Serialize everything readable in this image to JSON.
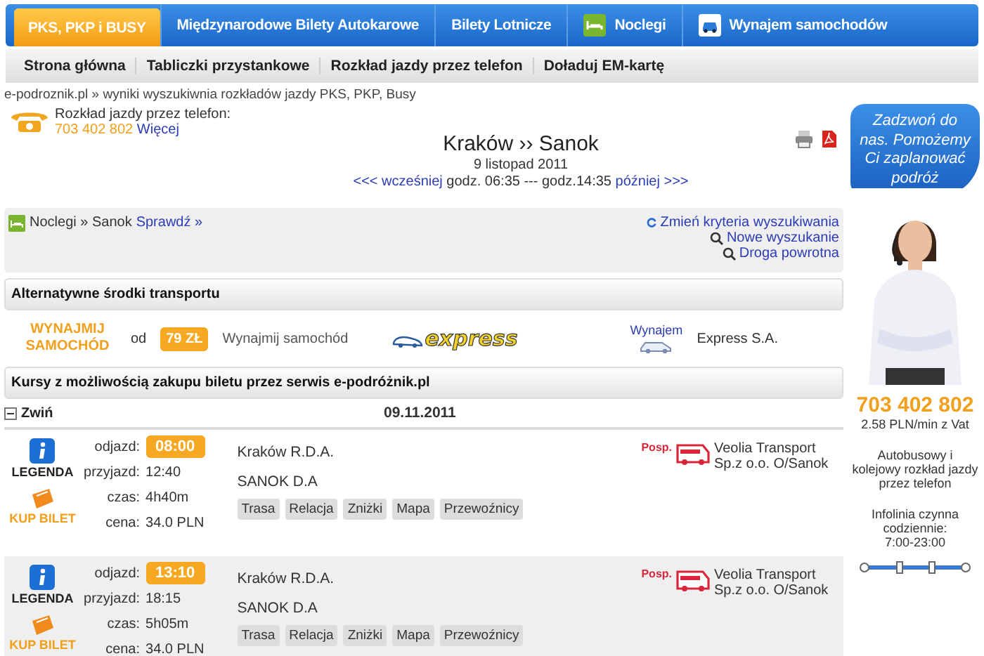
{
  "tabs": [
    {
      "label": "PKS, PKP i BUSY",
      "selected": true
    },
    {
      "label": "Międzynarodowe Bilety Autokarowe",
      "selected": false
    },
    {
      "label": "Bilety Lotnicze",
      "selected": false
    },
    {
      "label": "Noclegi",
      "selected": false
    },
    {
      "label": "Wynajem samochodów",
      "selected": false
    }
  ],
  "subnav": [
    "Strona główna",
    "Tabliczki przystankowe",
    "Rozkład jazdy przez telefon",
    "Doładuj EM-kartę"
  ],
  "breadcrumb": "e-podroznik.pl » wyniki wyszukiwnia rozkładów jazdy PKS, PKP, Busy",
  "phone_info": {
    "label": "Rozkład jazdy przez telefon:",
    "number": "703 402 802",
    "link": "Więcej"
  },
  "route": {
    "title": "Kraków ›› Sanok",
    "date": "9 listopad 2011",
    "earlier": "<<< wcześniej",
    "range": "godz. 06:35 --- godz.14:35",
    "later": "później >>>"
  },
  "options": {
    "lodging": "Noclegi » Sanok",
    "check": "Sprawdź »",
    "links": [
      "Zmień kryteria wyszukiwania",
      "Nowe wyszukanie",
      "Droga powrotna"
    ]
  },
  "alternatives": {
    "heading": "Alternatywne środki transportu",
    "promo": "WYNAJMIJ SAMOCHÓD",
    "from": "od",
    "price": "79 ZŁ",
    "label": "Wynajmij samochód",
    "logo": "express",
    "rent": "Wynajem",
    "company": "Express S.A."
  },
  "courses": {
    "heading": "Kursy z możliwością zakupu biletu przez serwis e-podróżnik.pl",
    "collapse": "Zwiń",
    "date": "09.11.2011",
    "rows": [
      {
        "legend": "LEGENDA",
        "buy": "KUP BILET",
        "departure_label": "odjazd:",
        "departure": "08:00",
        "arrival_label": "przyjazd:",
        "arrival": "12:40",
        "time_label": "czas:",
        "time": "4h40m",
        "price_label": "cena:",
        "price": "34.0 PLN",
        "from": "Kraków R.D.A.",
        "to": "SANOK D.A",
        "buttons": [
          "Trasa",
          "Relacja",
          "Zniżki",
          "Mapa",
          "Przewoźnicy"
        ],
        "badge": "Posp.",
        "carrier": "Veolia Transport Sp.z o.o. O/Sanok"
      },
      {
        "legend": "LEGENDA",
        "buy": "KUP BILET",
        "departure_label": "odjazd:",
        "departure": "13:10",
        "arrival_label": "przyjazd:",
        "arrival": "18:15",
        "time_label": "czas:",
        "time": "5h05m",
        "price_label": "cena:",
        "price": "34.0 PLN",
        "from": "Kraków R.D.A.",
        "to": "SANOK D.A",
        "buttons": [
          "Trasa",
          "Relacja",
          "Zniżki",
          "Mapa",
          "Przewoźnicy"
        ],
        "badge": "Posp.",
        "carrier": "Veolia Transport Sp.z o.o. O/Sanok"
      }
    ]
  },
  "sidebar": {
    "bubble": "Zadzwoń do nas. Pomożemy Ci zaplanować podróż",
    "phone": "703 402 802",
    "rate": "2.58 PLN/min z Vat",
    "info": "Autobusowy i kolejowy rozkład jazdy przez telefon",
    "hours_label": "Infolinia czynna codziennie:",
    "hours": "7:00-23:00"
  }
}
